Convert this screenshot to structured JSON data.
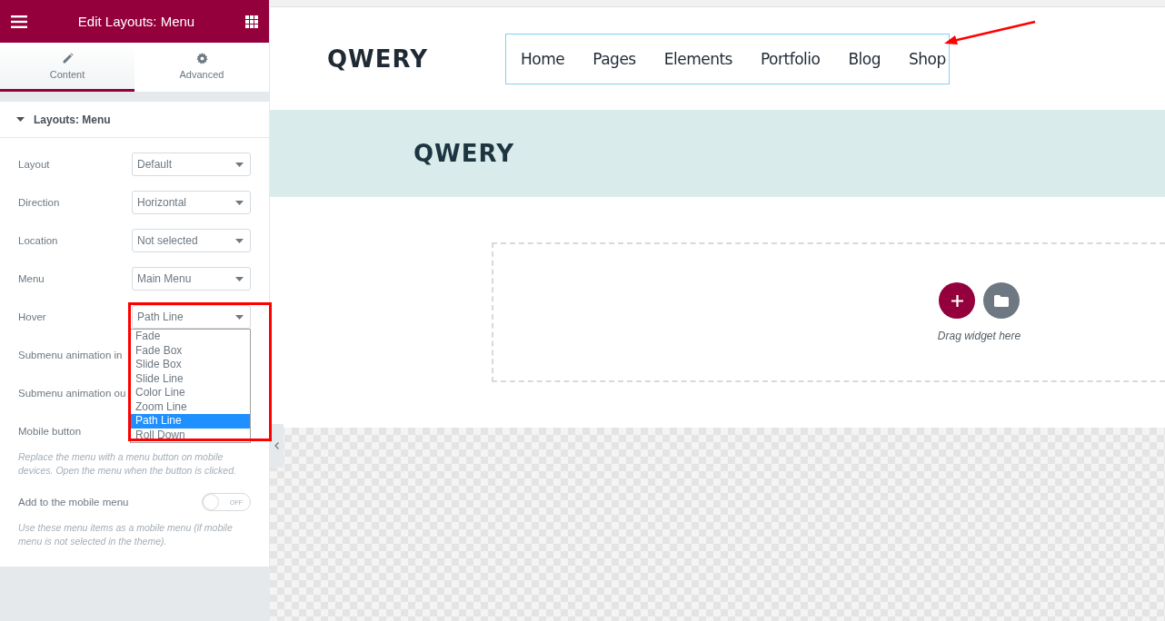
{
  "panel": {
    "title": "Edit Layouts: Menu",
    "tabs": [
      {
        "label": "Content",
        "selected": true
      },
      {
        "label": "Advanced",
        "selected": false
      }
    ],
    "section": {
      "title": "Layouts: Menu",
      "expanded": true
    },
    "controls": [
      {
        "kind": "select",
        "label": "Layout",
        "value": "Default"
      },
      {
        "kind": "select",
        "label": "Direction",
        "value": "Horizontal"
      },
      {
        "kind": "select",
        "label": "Location",
        "value": "Not selected"
      },
      {
        "kind": "select",
        "label": "Menu",
        "value": "Main Menu"
      },
      {
        "kind": "select",
        "label": "Hover",
        "value": "Path Line",
        "expanded": true,
        "options": [
          {
            "label": "Fade",
            "selected": false
          },
          {
            "label": "Fade Box",
            "selected": false
          },
          {
            "label": "Slide Box",
            "selected": false
          },
          {
            "label": "Slide Line",
            "selected": false
          },
          {
            "label": "Color Line",
            "selected": false
          },
          {
            "label": "Zoom Line",
            "selected": false
          },
          {
            "label": "Path Line",
            "selected": true
          },
          {
            "label": "Roll Down",
            "selected": false
          }
        ]
      },
      {
        "kind": "label",
        "label": "Submenu animation in"
      },
      {
        "kind": "label",
        "label": "Submenu animation ou"
      },
      {
        "kind": "label",
        "label": "Mobile button"
      },
      {
        "kind": "note",
        "text": "Replace the menu with a menu button on mobile devices. Open the menu when the button is clicked."
      },
      {
        "kind": "switch",
        "label": "Add to the mobile menu",
        "checked": false,
        "state_text": "OFF"
      },
      {
        "kind": "note",
        "text": "Use these menu items as a mobile menu (if mobile menu is not selected in the theme)."
      }
    ]
  },
  "preview": {
    "logo": "QWERY",
    "nav": [
      {
        "label": "Home"
      },
      {
        "label": "Pages"
      },
      {
        "label": "Elements"
      },
      {
        "label": "Portfolio"
      },
      {
        "label": "Blog"
      },
      {
        "label": "Shop"
      }
    ],
    "banner_title": "QWERY",
    "drop_zone": {
      "hint": "Drag widget here"
    }
  }
}
